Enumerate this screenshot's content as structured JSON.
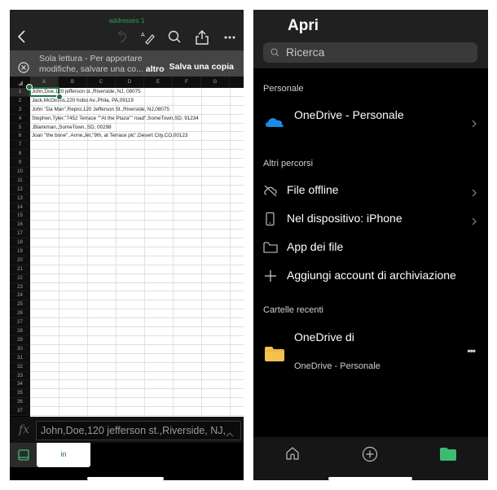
{
  "excel": {
    "title": "addresses 1",
    "toolbar": {
      "back_icon": "chevron-left-icon",
      "undo_icon": "undo-icon",
      "draw_icon": "draw-pen-icon",
      "search_icon": "search-icon",
      "share_icon": "share-icon",
      "more_icon": "more-horizontal-icon"
    },
    "readonly_banner": {
      "text": "Sola lettura - Per apportare modifiche, salvare una co...",
      "more_link": "altro",
      "save_copy_button": "Salva una copia"
    },
    "columns": [
      "A",
      "B",
      "C",
      "D",
      "E",
      "F",
      "G"
    ],
    "row_numbers": [
      "1",
      "2",
      "3",
      "4",
      "5",
      "6",
      "7",
      "8",
      "9",
      "10",
      "11",
      "12",
      "13",
      "14",
      "15",
      "16",
      "17",
      "18",
      "19",
      "20",
      "21",
      "22",
      "23",
      "24",
      "25",
      "26",
      "27",
      "28",
      "29",
      "30",
      "31",
      "32",
      "33",
      "34",
      "35",
      "36",
      "37"
    ],
    "rows": [
      "John,Doe,120 jefferson st.,Riverside, NJ, 08075",
      "Jack,McGinnis,220 hobo Av.,Phila, PA,09119",
      "John \"Da Man\",Repici,120 Jefferson St.,Riverside, NJ,08075",
      "Stephen,Tyler,\"7452 Terrace \"\"At the Plaza\"\" road\",SomeTown,SD, 91234",
      ",Blankman,,SomeTown, SD, 00298",
      "Joan \"the bone\", Anne,Jet,\"9th, at Terrace plc\",Desert City,CO,00123"
    ],
    "selected_cell": "A1",
    "formula_bar": {
      "label": "fx",
      "value": "John,Doe,120 jefferson st.,Riverside, NJ,"
    },
    "sheet_tab": "in",
    "accent_color": "#1e7145"
  },
  "open_panel": {
    "title": "Apri",
    "search_placeholder": "Ricerca",
    "sections": {
      "personal_label": "Personale",
      "other_label": "Altri percorsi",
      "recent_label": "Cartelle recenti"
    },
    "personal_items": [
      {
        "label": "OneDrive - Personale",
        "icon": "onedrive-cloud-icon",
        "has_chevron": true
      }
    ],
    "other_items": [
      {
        "label": "File offline",
        "icon": "cloud-offline-icon",
        "has_chevron": true
      },
      {
        "label": "Nel dispositivo: iPhone",
        "icon": "phone-icon",
        "has_chevron": true
      },
      {
        "label": "App dei file",
        "icon": "folder-outline-icon",
        "has_chevron": false
      },
      {
        "label": "Aggiungi account di archiviazione",
        "icon": "plus-icon",
        "has_chevron": false
      }
    ],
    "recent_folders": [
      {
        "name": "OneDrive di",
        "location": "OneDrive - Personale",
        "icon": "folder-icon",
        "more": "•••"
      }
    ],
    "tabbar": [
      {
        "name": "home",
        "icon": "home-icon",
        "active": false
      },
      {
        "name": "new",
        "icon": "plus-circle-icon",
        "active": false
      },
      {
        "name": "open",
        "icon": "folder-filled-icon",
        "active": true
      }
    ],
    "active_color": "#3dbb72",
    "folder_color": "#f4c04e"
  }
}
